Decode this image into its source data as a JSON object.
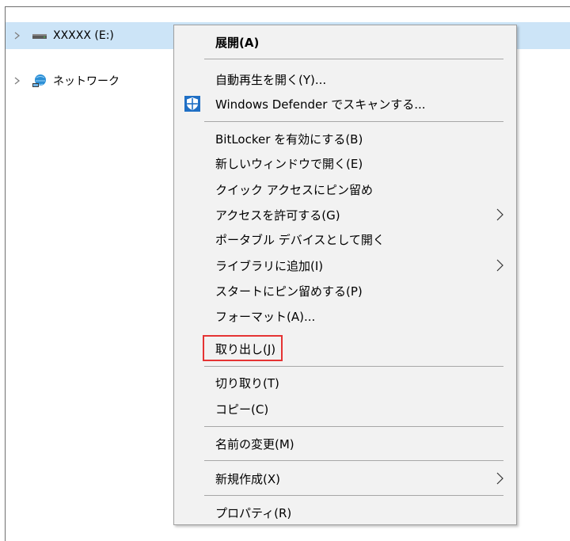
{
  "tree": {
    "drive_label": "XXXXX (E:)",
    "network_label": "ネットワーク"
  },
  "context_menu": {
    "items": [
      {
        "label": "展開(A)",
        "bold": true
      },
      {
        "label": "自動再生を開く(Y)..."
      },
      {
        "label": "Windows Defender でスキャンする...",
        "icon": "windows-defender-icon"
      },
      {
        "label": "BitLocker を有効にする(B)"
      },
      {
        "label": "新しいウィンドウで開く(E)"
      },
      {
        "label": "クイック アクセスにピン留め"
      },
      {
        "label": "アクセスを許可する(G)",
        "submenu": true
      },
      {
        "label": "ポータブル デバイスとして開く"
      },
      {
        "label": "ライブラリに追加(I)",
        "submenu": true
      },
      {
        "label": "スタートにピン留めする(P)"
      },
      {
        "label": "フォーマット(A)..."
      },
      {
        "label": "取り出し(J)",
        "highlighted": true
      },
      {
        "label": "切り取り(T)"
      },
      {
        "label": "コピー(C)"
      },
      {
        "label": "名前の変更(M)"
      },
      {
        "label": "新規作成(X)",
        "submenu": true
      },
      {
        "label": "プロパティ(R)"
      }
    ]
  },
  "colors": {
    "selection": "#cce4f7",
    "menu_background": "#f2f2f2",
    "highlight_box": "#e53333",
    "defender_blue": "#1f6fc5"
  }
}
